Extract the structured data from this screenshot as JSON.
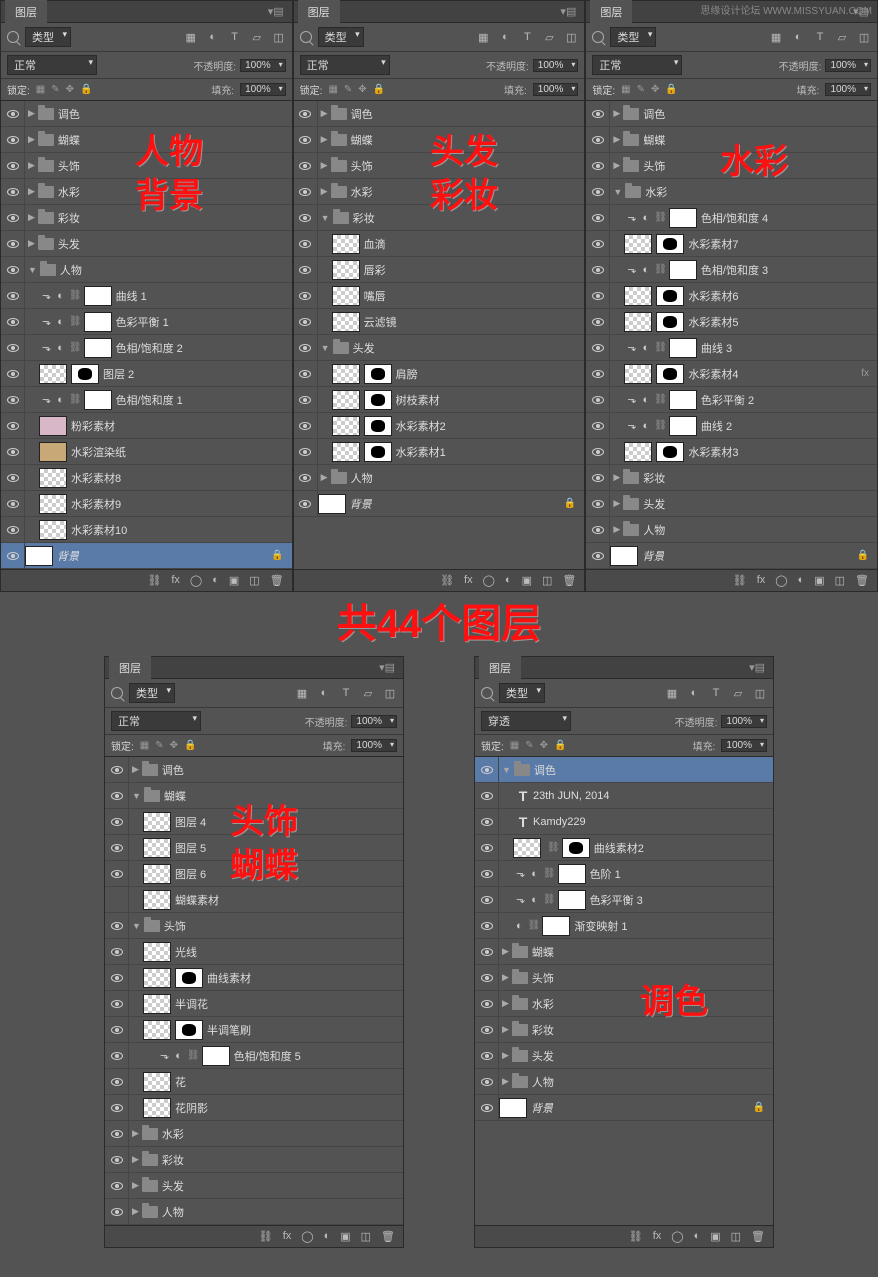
{
  "watermark": "思缘设计论坛 WWW.MISSYUAN.COM",
  "common": {
    "tab": "图层",
    "type": "类型",
    "blend_normal": "正常",
    "blend_pass": "穿透",
    "opacity_label": "不透明度:",
    "opacity_val": "100%",
    "lock_label": "锁定:",
    "fill_label": "填充:",
    "fill_val": "100%"
  },
  "annotations": {
    "a1_l1": "人物",
    "a1_l2": "背景",
    "a2_l1": "头发",
    "a2_l2": "彩妆",
    "a3": "水彩",
    "mid": "共44个图层",
    "a4_l1": "头饰",
    "a4_l2": "蝴蝶",
    "a5": "调色"
  },
  "p1": [
    {
      "t": "folder",
      "name": "调色",
      "open": false
    },
    {
      "t": "folder",
      "name": "蝴蝶",
      "open": false
    },
    {
      "t": "folder",
      "name": "头饰",
      "open": false
    },
    {
      "t": "folder",
      "name": "水彩",
      "open": false
    },
    {
      "t": "folder",
      "name": "彩妆",
      "open": false
    },
    {
      "t": "folder",
      "name": "头发",
      "open": false
    },
    {
      "t": "folder",
      "name": "人物",
      "open": true
    },
    {
      "t": "adj",
      "name": "曲线 1",
      "ind": 1
    },
    {
      "t": "adj",
      "name": "色彩平衡 1",
      "ind": 1
    },
    {
      "t": "adj",
      "name": "色相/饱和度 2",
      "ind": 1
    },
    {
      "t": "layer",
      "name": "图层 2",
      "ind": 1,
      "mask": true,
      "thumb": "checker"
    },
    {
      "t": "adj",
      "name": "色相/饱和度 1",
      "ind": 1
    },
    {
      "t": "layer",
      "name": "粉彩素材",
      "ind": 1,
      "thumb": "pink"
    },
    {
      "t": "layer",
      "name": "水彩渲染纸",
      "ind": 1,
      "thumb": "tan"
    },
    {
      "t": "layer",
      "name": "水彩素材8",
      "ind": 1,
      "thumb": "checker"
    },
    {
      "t": "layer",
      "name": "水彩素材9",
      "ind": 1,
      "thumb": "checker"
    },
    {
      "t": "layer",
      "name": "水彩素材10",
      "ind": 1,
      "thumb": "checker"
    },
    {
      "t": "bg",
      "name": "背景",
      "sel": true
    }
  ],
  "p2": [
    {
      "t": "folder",
      "name": "调色",
      "open": false
    },
    {
      "t": "folder",
      "name": "蝴蝶",
      "open": false
    },
    {
      "t": "folder",
      "name": "头饰",
      "open": false
    },
    {
      "t": "folder",
      "name": "水彩",
      "open": false
    },
    {
      "t": "folder",
      "name": "彩妆",
      "open": true
    },
    {
      "t": "layer",
      "name": "血滴",
      "ind": 1,
      "thumb": "checker"
    },
    {
      "t": "layer",
      "name": "唇彩",
      "ind": 1,
      "thumb": "checker"
    },
    {
      "t": "layer",
      "name": "嘴唇",
      "ind": 1,
      "thumb": "checker"
    },
    {
      "t": "layer",
      "name": "云滤镜",
      "ind": 1,
      "thumb": "checker"
    },
    {
      "t": "folder",
      "name": "头发",
      "open": true
    },
    {
      "t": "layer",
      "name": "肩膀",
      "ind": 1,
      "mask": true,
      "thumb": "checker"
    },
    {
      "t": "layer",
      "name": "树枝素材",
      "ind": 1,
      "mask": true,
      "thumb": "checker"
    },
    {
      "t": "layer",
      "name": "水彩素材2",
      "ind": 1,
      "mask": true,
      "thumb": "checker"
    },
    {
      "t": "layer",
      "name": "水彩素材1",
      "ind": 1,
      "mask": true,
      "thumb": "checker"
    },
    {
      "t": "folder",
      "name": "人物",
      "open": false
    },
    {
      "t": "bg",
      "name": "背景",
      "lock": true
    }
  ],
  "p3": [
    {
      "t": "folder",
      "name": "调色",
      "open": false
    },
    {
      "t": "folder",
      "name": "蝴蝶",
      "open": false
    },
    {
      "t": "folder",
      "name": "头饰",
      "open": false
    },
    {
      "t": "folder",
      "name": "水彩",
      "open": true
    },
    {
      "t": "adj",
      "name": "色相/饱和度 4",
      "ind": 1
    },
    {
      "t": "layer",
      "name": "水彩素材7",
      "ind": 1,
      "mask": true,
      "thumb": "checker"
    },
    {
      "t": "adj",
      "name": "色相/饱和度 3",
      "ind": 1
    },
    {
      "t": "layer",
      "name": "水彩素材6",
      "ind": 1,
      "mask": true,
      "thumb": "checker"
    },
    {
      "t": "layer",
      "name": "水彩素材5",
      "ind": 1,
      "mask": true,
      "thumb": "checker"
    },
    {
      "t": "adj",
      "name": "曲线 3",
      "ind": 1
    },
    {
      "t": "layer",
      "name": "水彩素材4",
      "ind": 1,
      "mask": true,
      "thumb": "checker",
      "fx": true
    },
    {
      "t": "adj",
      "name": "色彩平衡 2",
      "ind": 1
    },
    {
      "t": "adj",
      "name": "曲线 2",
      "ind": 1
    },
    {
      "t": "layer",
      "name": "水彩素材3",
      "ind": 1,
      "mask": true,
      "thumb": "checker"
    },
    {
      "t": "folder",
      "name": "彩妆",
      "open": false
    },
    {
      "t": "folder",
      "name": "头发",
      "open": false
    },
    {
      "t": "folder",
      "name": "人物",
      "open": false
    },
    {
      "t": "bg",
      "name": "背景",
      "lock": true
    }
  ],
  "p4": [
    {
      "t": "folder",
      "name": "调色",
      "open": false
    },
    {
      "t": "folder",
      "name": "蝴蝶",
      "open": true
    },
    {
      "t": "layer",
      "name": "图层 4",
      "ind": 1,
      "thumb": "checker"
    },
    {
      "t": "layer",
      "name": "图层 5",
      "ind": 1,
      "thumb": "checker"
    },
    {
      "t": "layer",
      "name": "图层 6",
      "ind": 1,
      "thumb": "checker"
    },
    {
      "t": "layer",
      "name": "蝴蝶素材",
      "ind": 1,
      "thumb": "checker",
      "novis": true
    },
    {
      "t": "folder",
      "name": "头饰",
      "open": true
    },
    {
      "t": "layer",
      "name": "光线",
      "ind": 1,
      "thumb": "checker"
    },
    {
      "t": "layer",
      "name": "曲线素材",
      "ind": 1,
      "mask": true,
      "thumb": "checker"
    },
    {
      "t": "layer",
      "name": "半调花",
      "ind": 1,
      "thumb": "checker"
    },
    {
      "t": "layer",
      "name": "半调笔刷",
      "ind": 1,
      "mask": true,
      "thumb": "checker"
    },
    {
      "t": "adj",
      "name": "色相/饱和度 5",
      "ind": 2
    },
    {
      "t": "layer",
      "name": "花",
      "ind": 1,
      "thumb": "checker"
    },
    {
      "t": "layer",
      "name": "花阴影",
      "ind": 1,
      "thumb": "checker"
    },
    {
      "t": "folder",
      "name": "水彩",
      "open": false
    },
    {
      "t": "folder",
      "name": "彩妆",
      "open": false
    },
    {
      "t": "folder",
      "name": "头发",
      "open": false
    },
    {
      "t": "folder",
      "name": "人物",
      "open": false
    }
  ],
  "p5": [
    {
      "t": "folder",
      "name": "调色",
      "open": true,
      "sel": true
    },
    {
      "t": "text",
      "name": "23th JUN, 2014",
      "ind": 1
    },
    {
      "t": "text",
      "name": "Kamdy229",
      "ind": 1
    },
    {
      "t": "layer",
      "name": "曲线素材2",
      "ind": 1,
      "mask": true,
      "thumb": "checker",
      "link": true
    },
    {
      "t": "adj",
      "name": "色阶 1",
      "ind": 1
    },
    {
      "t": "adj",
      "name": "色彩平衡 3",
      "ind": 1
    },
    {
      "t": "adj2",
      "name": "渐变映射 1",
      "ind": 1
    },
    {
      "t": "folder",
      "name": "蝴蝶",
      "open": false
    },
    {
      "t": "folder",
      "name": "头饰",
      "open": false
    },
    {
      "t": "folder",
      "name": "水彩",
      "open": false
    },
    {
      "t": "folder",
      "name": "彩妆",
      "open": false
    },
    {
      "t": "folder",
      "name": "头发",
      "open": false
    },
    {
      "t": "folder",
      "name": "人物",
      "open": false
    },
    {
      "t": "bg",
      "name": "背景",
      "lock": true
    }
  ]
}
